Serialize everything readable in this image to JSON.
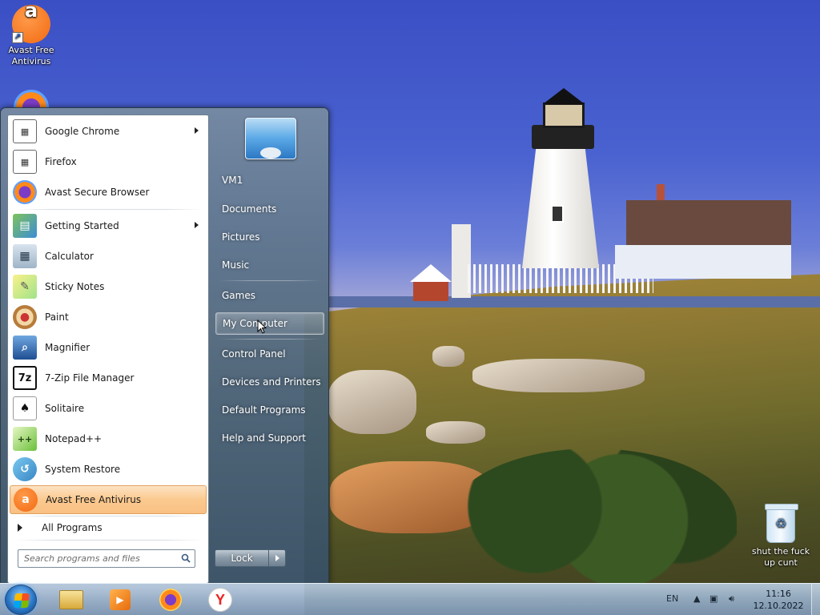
{
  "desktop": {
    "icons": [
      {
        "label": "Avast Free Antivirus"
      },
      {
        "label": "shut the fuck up cunt"
      }
    ]
  },
  "start_menu": {
    "programs": [
      {
        "label": "Google Chrome",
        "icon": "chrome-icon",
        "has_submenu": true
      },
      {
        "label": "Firefox",
        "icon": "firefox-icon",
        "has_submenu": false
      },
      {
        "label": "Avast Secure Browser",
        "icon": "avast-browser-icon",
        "has_submenu": false
      },
      {
        "label": "Getting Started",
        "icon": "getting-started-icon",
        "has_submenu": true
      },
      {
        "label": "Calculator",
        "icon": "calculator-icon",
        "has_submenu": false
      },
      {
        "label": "Sticky Notes",
        "icon": "sticky-notes-icon",
        "has_submenu": false
      },
      {
        "label": "Paint",
        "icon": "paint-icon",
        "has_submenu": false
      },
      {
        "label": "Magnifier",
        "icon": "magnifier-icon",
        "has_submenu": false
      },
      {
        "label": "7-Zip File Manager",
        "icon": "7zip-icon",
        "has_submenu": false
      },
      {
        "label": "Solitaire",
        "icon": "solitaire-icon",
        "has_submenu": false
      },
      {
        "label": "Notepad++",
        "icon": "notepadpp-icon",
        "has_submenu": false
      },
      {
        "label": "System Restore",
        "icon": "system-restore-icon",
        "has_submenu": false
      },
      {
        "label": "Avast Free Antivirus",
        "icon": "avast-icon",
        "has_submenu": false,
        "highlighted": true
      }
    ],
    "all_programs_label": "All Programs",
    "search_placeholder": "Search programs and files",
    "right_items": [
      {
        "label": "VM1"
      },
      {
        "label": "Documents"
      },
      {
        "label": "Pictures"
      },
      {
        "label": "Music"
      },
      {
        "label": "Games"
      },
      {
        "label": "My Computer",
        "hover": true
      },
      {
        "label": "Control Panel"
      },
      {
        "label": "Devices and Printers"
      },
      {
        "label": "Default Programs"
      },
      {
        "label": "Help and Support"
      }
    ],
    "lock_label": "Lock"
  },
  "taskbar": {
    "pinned": [
      "explorer-icon",
      "media-player-icon",
      "avast-browser-icon",
      "yandex-browser-icon"
    ],
    "language": "EN",
    "time": "11:16",
    "date": "12.10.2022"
  },
  "colors": {
    "highlight": "#fbc98f",
    "avast_orange": "#f26a12"
  }
}
